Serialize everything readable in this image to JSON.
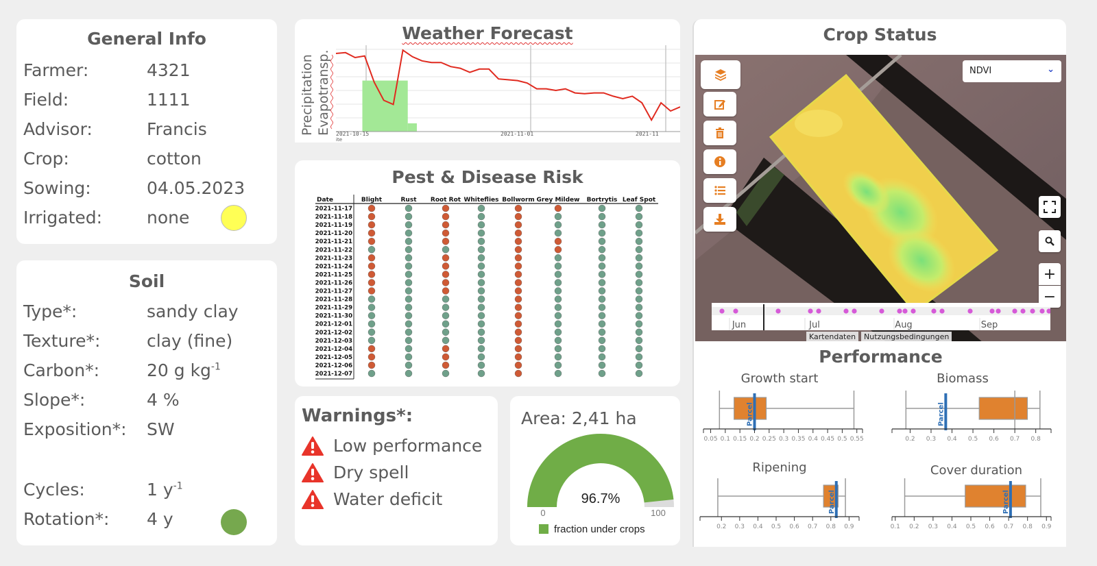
{
  "general": {
    "title": "General Info",
    "rows": [
      {
        "label": "Farmer:",
        "value": "4321"
      },
      {
        "label": "Field:",
        "value": "1111"
      },
      {
        "label": "Advisor:",
        "value": "Francis"
      },
      {
        "label": "Crop:",
        "value": "cotton"
      },
      {
        "label": "Sowing:",
        "value": "04.05.2023"
      },
      {
        "label": "Irrigated:",
        "value": "none"
      }
    ],
    "irrigated_indicator_color": "#ffff55"
  },
  "soil": {
    "title": "Soil",
    "rows": [
      {
        "label": "Type*:",
        "value": "sandy clay",
        "sup": ""
      },
      {
        "label": "Texture*:",
        "value": "clay (fine)",
        "sup": ""
      },
      {
        "label": "Carbon*:",
        "value": "20 g kg",
        "sup": "-1"
      },
      {
        "label": "Slope*:",
        "value": "4 %",
        "sup": ""
      },
      {
        "label": "Exposition*:",
        "value": "SW",
        "sup": ""
      }
    ],
    "rows2": [
      {
        "label": "Cycles:",
        "value": "1 y",
        "sup": "-1"
      },
      {
        "label": "Rotation*:",
        "value": "4 y",
        "sup": ""
      }
    ],
    "rotation_indicator_color": "#76a84e"
  },
  "weather": {
    "title": "Weather Forecast",
    "ylabel1": "Precipitation",
    "ylabel2": "Evapotransp.",
    "xlabel_partial": "ite",
    "x_ticks": [
      "2021-10-15",
      "2021-11-01",
      "2021-11"
    ],
    "et_series": [
      0.95,
      0.96,
      0.9,
      0.92,
      0.6,
      0.38,
      0.33,
      0.99,
      0.91,
      0.86,
      0.84,
      0.84,
      0.79,
      0.77,
      0.72,
      0.76,
      0.76,
      0.64,
      0.63,
      0.62,
      0.59,
      0.52,
      0.52,
      0.5,
      0.52,
      0.47,
      0.46,
      0.47,
      0.47,
      0.43,
      0.4,
      0.43,
      0.35,
      0.14,
      0.35,
      0.25,
      0.3
    ],
    "precip_bars": [
      {
        "start": 2,
        "end": 7,
        "value": 0.62
      },
      {
        "start": 7,
        "end": 8,
        "value": 0.1
      }
    ],
    "colors": {
      "et": "#e02a1f",
      "precip": "#a3e896"
    }
  },
  "pest": {
    "title": "Pest & Disease Risk",
    "columns": [
      "Date",
      "Blight",
      "Rust",
      "Root Rot",
      "Whiteflies",
      "Bollworm",
      "Grey Mildew",
      "Bortrytis",
      "Leaf Spot"
    ],
    "dates": [
      "2021-11-17",
      "2021-11-18",
      "2021-11-19",
      "2021-11-20",
      "2021-11-21",
      "2021-11-22",
      "2021-11-23",
      "2021-11-24",
      "2021-11-25",
      "2021-11-26",
      "2021-11-27",
      "2021-11-28",
      "2021-11-29",
      "2021-11-30",
      "2021-12-01",
      "2021-12-02",
      "2021-12-03",
      "2021-12-04",
      "2021-12-05",
      "2021-12-06",
      "2021-12-07"
    ],
    "risk": [
      [
        1,
        0,
        1,
        0,
        1,
        1,
        0,
        0
      ],
      [
        1,
        0,
        1,
        0,
        1,
        0,
        0,
        0
      ],
      [
        1,
        0,
        1,
        0,
        1,
        0,
        0,
        0
      ],
      [
        1,
        0,
        1,
        0,
        1,
        0,
        0,
        0
      ],
      [
        1,
        0,
        1,
        0,
        1,
        1,
        0,
        0
      ],
      [
        0,
        0,
        0,
        0,
        1,
        1,
        0,
        0
      ],
      [
        1,
        0,
        1,
        0,
        1,
        0,
        0,
        0
      ],
      [
        1,
        0,
        1,
        0,
        1,
        0,
        0,
        0
      ],
      [
        1,
        0,
        1,
        0,
        1,
        0,
        0,
        0
      ],
      [
        1,
        0,
        1,
        0,
        1,
        0,
        0,
        0
      ],
      [
        1,
        0,
        1,
        0,
        1,
        0,
        0,
        0
      ],
      [
        0,
        0,
        0,
        0,
        1,
        0,
        0,
        0
      ],
      [
        0,
        0,
        0,
        0,
        1,
        0,
        0,
        0
      ],
      [
        0,
        0,
        0,
        0,
        1,
        0,
        0,
        0
      ],
      [
        0,
        0,
        0,
        0,
        1,
        0,
        0,
        0
      ],
      [
        0,
        0,
        0,
        0,
        1,
        0,
        0,
        0
      ],
      [
        0,
        0,
        0,
        0,
        1,
        0,
        0,
        0
      ],
      [
        1,
        0,
        1,
        0,
        1,
        0,
        0,
        0
      ],
      [
        1,
        0,
        1,
        0,
        1,
        0,
        0,
        0
      ],
      [
        1,
        0,
        1,
        0,
        1,
        0,
        0,
        0
      ],
      [
        0,
        0,
        0,
        0,
        1,
        0,
        0,
        0
      ]
    ],
    "colors": {
      "high": "#cf5a35",
      "low": "#6fa08a"
    }
  },
  "warnings": {
    "title": "Warnings*:",
    "items": [
      "Low performance",
      "Dry spell",
      "Water deficit"
    ],
    "icon_color": "#e8342a"
  },
  "area": {
    "title": "Area: 2,41 ha",
    "percent": 96.7,
    "percent_label": "96.7%",
    "min_label": "0",
    "max_label": "100",
    "legend": "fraction under crops",
    "color": "#70ad47"
  },
  "crop": {
    "title": "Crop Status",
    "layer_select": "NDVI",
    "tools": [
      "layers-icon",
      "edit-icon",
      "trash-icon",
      "info-icon",
      "list-icon",
      "download-icon"
    ],
    "timeline_months": [
      "Jun",
      "Jul",
      "Aug",
      "Sep"
    ],
    "attrib": [
      "Kartendaten",
      "Nutzungsbedingungen"
    ],
    "tool_color": "#e67e22"
  },
  "performance": {
    "title": "Performance",
    "charts": [
      {
        "title": "Growth start",
        "min": 0.08,
        "q1": 0.13,
        "q3": 0.24,
        "max": 0.54,
        "parcel": 0.2,
        "parcel_label": "Parcel",
        "axis": [
          0.03,
          0.56
        ],
        "ticks": [
          "0.05",
          "0.1",
          "0.15",
          "0.2",
          "0.25",
          "0.3",
          "0.35",
          "0.4",
          "0.45",
          "0.5",
          "0.55"
        ]
      },
      {
        "title": "Biomass",
        "min": 0.18,
        "q1": 0.53,
        "q3": 0.76,
        "max": 0.82,
        "parcel": 0.37,
        "median": 0.7,
        "parcel_label": "Parcel",
        "axis": [
          0.12,
          0.86
        ],
        "ticks": [
          "0.2",
          "0.3",
          "0.4",
          "0.5",
          "0.6",
          "0.7",
          "0.8"
        ]
      },
      {
        "title": "Ripening",
        "min": 0.18,
        "q1": 0.76,
        "q3": 0.84,
        "max": 0.88,
        "parcel": 0.83,
        "parcel_label": "Parcel",
        "axis": [
          0.09,
          0.94
        ],
        "ticks": [
          "0.2",
          "0.3",
          "0.4",
          "0.5",
          "0.6",
          "0.7",
          "0.8",
          "0.9"
        ]
      },
      {
        "title": "Cover duration",
        "min": 0.15,
        "q1": 0.47,
        "q3": 0.79,
        "max": 0.87,
        "parcel": 0.71,
        "parcel_label": "Parcel",
        "axis": [
          0.09,
          0.91
        ],
        "ticks": [
          "0.1",
          "0.2",
          "0.3",
          "0.4",
          "0.5",
          "0.6",
          "0.7",
          "0.8",
          "0.9"
        ]
      }
    ],
    "colors": {
      "box": "#e0822f",
      "parcel": "#2e6fb5",
      "whisker": "#9a9a9a"
    }
  }
}
